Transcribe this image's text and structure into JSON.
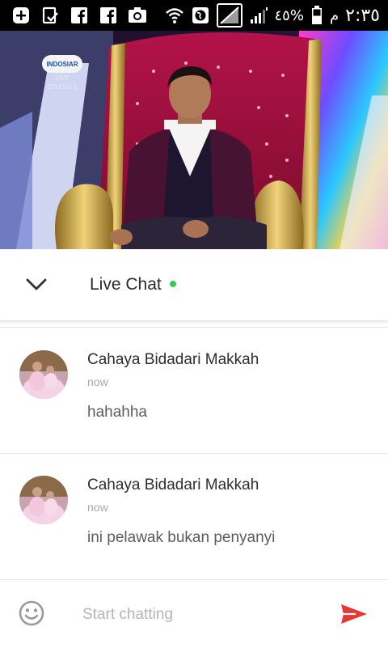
{
  "status_bar": {
    "battery_percent_label": "٤٥%",
    "time": "٢:٣٥",
    "ampm": "م",
    "icons": [
      "add-box-icon",
      "clipboard-check-icon",
      "facebook-icon",
      "facebook-icon",
      "camera-icon",
      "wifi-icon",
      "globe-icon",
      "no-signal-icon",
      "signal-icon",
      "battery-icon"
    ]
  },
  "video": {
    "channel_logo": "INDOSIAR",
    "channel_sub": "LIVE",
    "channel_sub2": "STUDIO 1"
  },
  "chat_header": {
    "title": "Live Chat",
    "status_color": "#37c759"
  },
  "messages": [
    {
      "author": "Cahaya Bidadari Makkah",
      "time": "now",
      "text": "hahahha"
    },
    {
      "author": "Cahaya Bidadari Makkah",
      "time": "now",
      "text": "ini pelawak bukan penyanyi"
    }
  ],
  "input": {
    "placeholder": "Start chatting",
    "accent_color": "#e53935"
  }
}
